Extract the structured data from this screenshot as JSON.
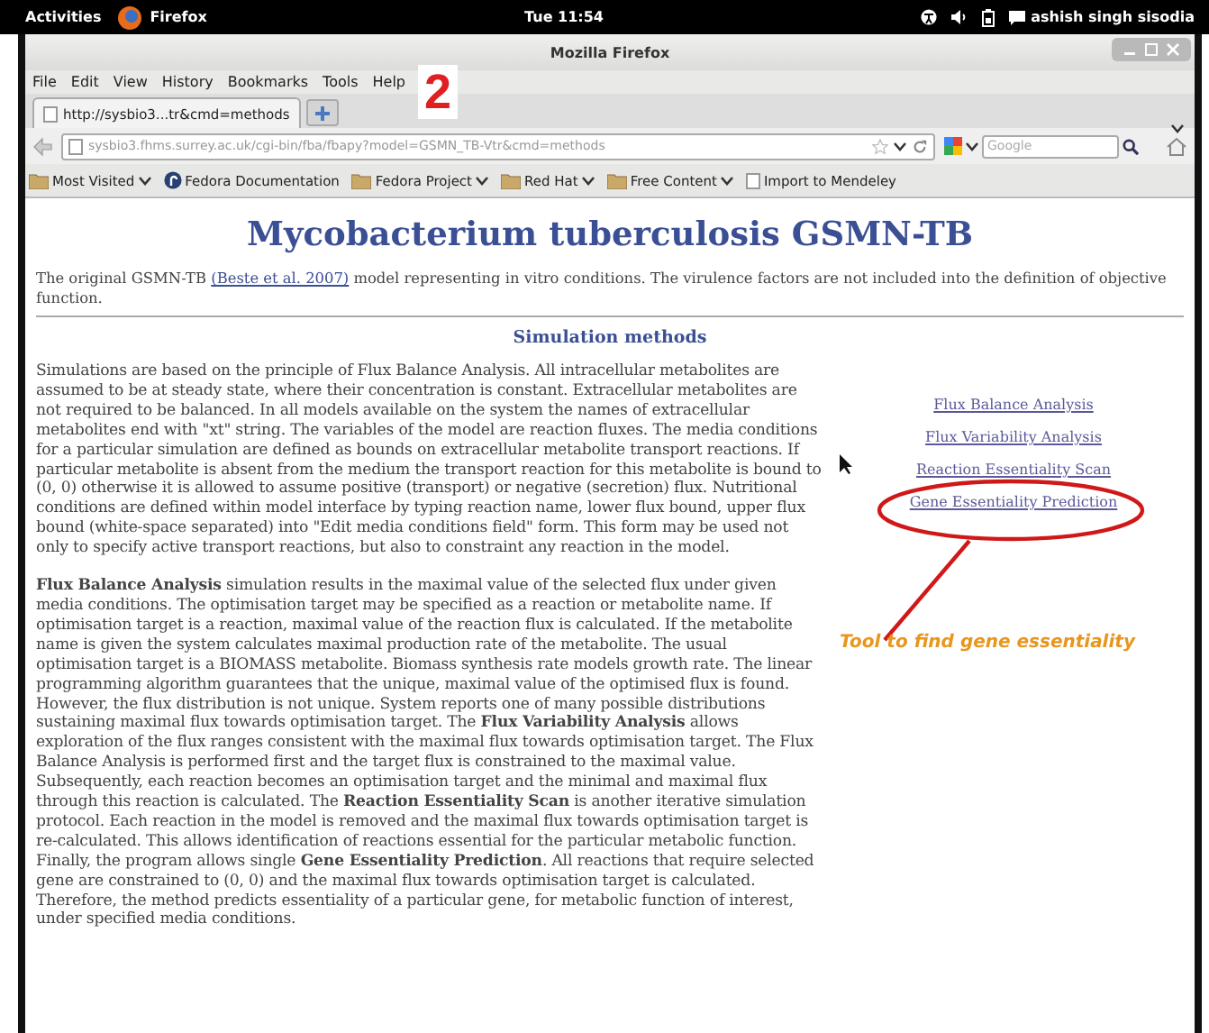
{
  "top_bar": {
    "activities": "Activities",
    "app": "Firefox",
    "clock": "Tue 11:54",
    "user": "ashish singh sisodia"
  },
  "window": {
    "title": "Mozilla Firefox"
  },
  "menu": [
    "File",
    "Edit",
    "View",
    "History",
    "Bookmarks",
    "Tools",
    "Help"
  ],
  "tabs": [
    {
      "label": "http://sysbio3...tr&cmd=methods",
      "selected": true
    }
  ],
  "address_bar": {
    "value": "sysbio3.fhms.surrey.ac.uk/cgi-bin/fba/fbapy?model=GSMN_TB-Vtr&cmd=methods"
  },
  "search": {
    "placeholder": "Google"
  },
  "bookmarks": [
    {
      "label": "Most Visited",
      "kind": "menu"
    },
    {
      "label": "Fedora Documentation",
      "kind": "link"
    },
    {
      "label": "Fedora Project",
      "kind": "menu"
    },
    {
      "label": "Red Hat",
      "kind": "menu"
    },
    {
      "label": "Free Content",
      "kind": "menu"
    },
    {
      "label": "Import to Mendeley",
      "kind": "bookmarklet"
    }
  ],
  "page": {
    "title": "Mycobacterium tuberculosis GSMN-TB",
    "intro": {
      "before": "The original GSMN-TB",
      "link": "(Beste et al. 2007)",
      "after": "model representing in vitro conditions. The virulence factors are not included into the definition of objective function."
    },
    "section_title": "Simulation methods",
    "paragraphs": [
      "Simulations are based on the principle of Flux Balance Analysis. All intracellular metabolites are assumed to be at steady state, where their concentration is constant. Extracellular metabolites are not required to be balanced. In all models available on the system the names of extracellular metabolites end with \"xt\" string. The variables of the model are reaction fluxes. The media conditions for a particular simulation are defined as bounds on extracellular metabolite transport reactions. If particular metabolite is absent from the medium the transport reaction for this metabolite is bound to (0, 0) otherwise it is allowed to assume positive (transport) or negative (secretion) flux. Nutritional conditions are defined within model interface by typing reaction name, lower flux bound, upper flux bound (white-space separated) into \"Edit media conditions field\" form. This form may be used not only to specify active transport reactions, but also to constraint any reaction in the model.",
      "**Flux Balance Analysis** simulation results in the maximal value of the selected flux under given media conditions. The optimisation target may be specified as a reaction or metabolite name. If optimisation target is a reaction, maximal value of the reaction flux is calculated. If the metabolite name is given the system calculates maximal production rate of the metabolite. The usual optimisation target is a BIOMASS metabolite. Biomass synthesis rate models growth rate. The linear programming algorithm guarantees that the unique, maximal value of the optimised flux is found. However, the flux distribution is not unique. System reports one of many possible distributions sustaining maximal flux towards optimisation target. The **Flux Variability Analysis** allows exploration of the flux ranges consistent with the maximal flux towards optimisation target. The Flux Balance Analysis is performed first and the target flux is constrained to the maximal value. Subsequently, each reaction becomes an optimisation target and the minimal and maximal flux through this reaction is calculated. The **Reaction Essentiality Scan** is another iterative simulation protocol. Each reaction in the model is removed and the maximal flux towards optimisation target is re-calculated. This allows identification of reactions essential for the particular metabolic function. Finally, the program allows single **Gene Essentiality Prediction**. All reactions that require selected gene are constrained to (0, 0) and the maximal flux towards optimisation target is calculated. Therefore, the method predicts essentiality of a particular gene, for metabolic function of interest, under specified media conditions."
    ],
    "method_links": [
      "Flux Balance Analysis",
      "Flux Variability Analysis",
      "Reaction Essentiality Scan",
      "Gene Essentiality Prediction"
    ]
  },
  "annotations": {
    "number": "2",
    "note": "Tool to find gene essentiality"
  }
}
